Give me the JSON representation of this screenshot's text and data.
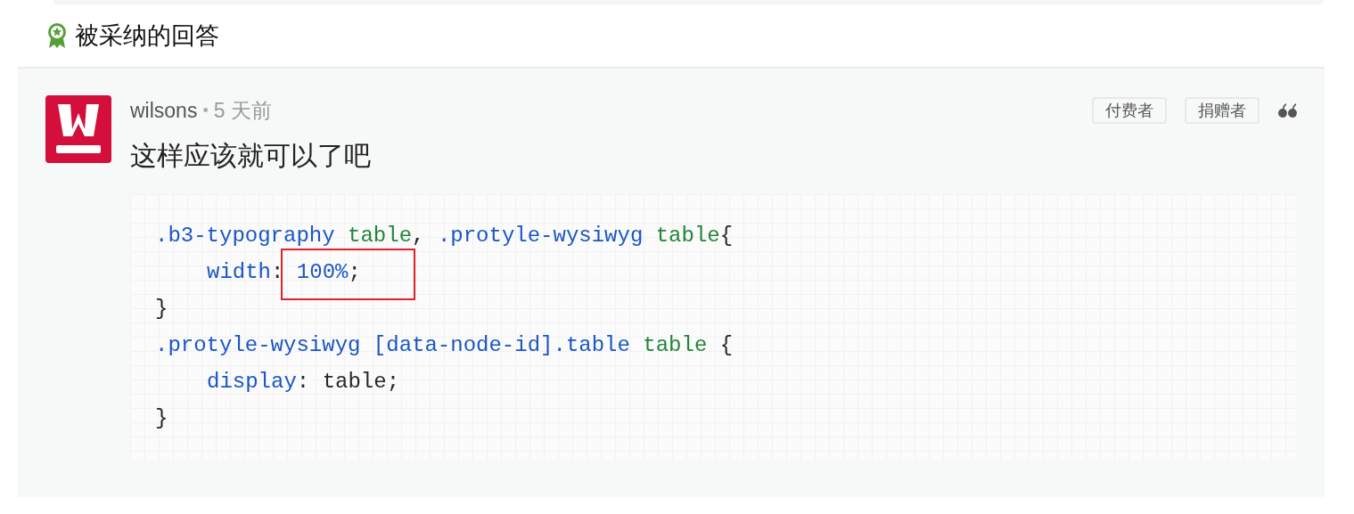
{
  "section_title": "被采纳的回答",
  "answer": {
    "author": "wilsons",
    "separator": "•",
    "time": "5 天前",
    "badges": [
      "付费者",
      "捐赠者"
    ],
    "content": "这样应该就可以了吧",
    "code": [
      {
        "indent": false,
        "highlighted": false,
        "tokens": [
          {
            "kind": "selector",
            "text": ".b3-typography"
          },
          {
            "kind": "tag",
            "text": " table"
          },
          {
            "kind": "plain",
            "text": ", "
          },
          {
            "kind": "selector",
            "text": ".protyle-wysiwyg"
          },
          {
            "kind": "tag",
            "text": " table"
          },
          {
            "kind": "plain",
            "text": "{"
          }
        ]
      },
      {
        "indent": true,
        "highlighted": true,
        "tokens": [
          {
            "kind": "selector",
            "text": "width"
          },
          {
            "kind": "plain",
            "text": ":"
          },
          {
            "kind": "selector",
            "text": " 100%"
          },
          {
            "kind": "plain",
            "text": ";"
          }
        ]
      },
      {
        "indent": false,
        "highlighted": false,
        "tokens": [
          {
            "kind": "plain",
            "text": "}"
          }
        ]
      },
      {
        "indent": false,
        "highlighted": false,
        "tokens": [
          {
            "kind": "selector",
            "text": ".protyle-wysiwyg [data-node-id].table"
          },
          {
            "kind": "tag",
            "text": " table"
          },
          {
            "kind": "plain",
            "text": " {"
          }
        ]
      },
      {
        "indent": true,
        "highlighted": false,
        "tokens": [
          {
            "kind": "selector",
            "text": "display"
          },
          {
            "kind": "plain",
            "text": ": table;"
          }
        ]
      },
      {
        "indent": false,
        "highlighted": false,
        "tokens": [
          {
            "kind": "plain",
            "text": "}"
          }
        ]
      }
    ]
  }
}
